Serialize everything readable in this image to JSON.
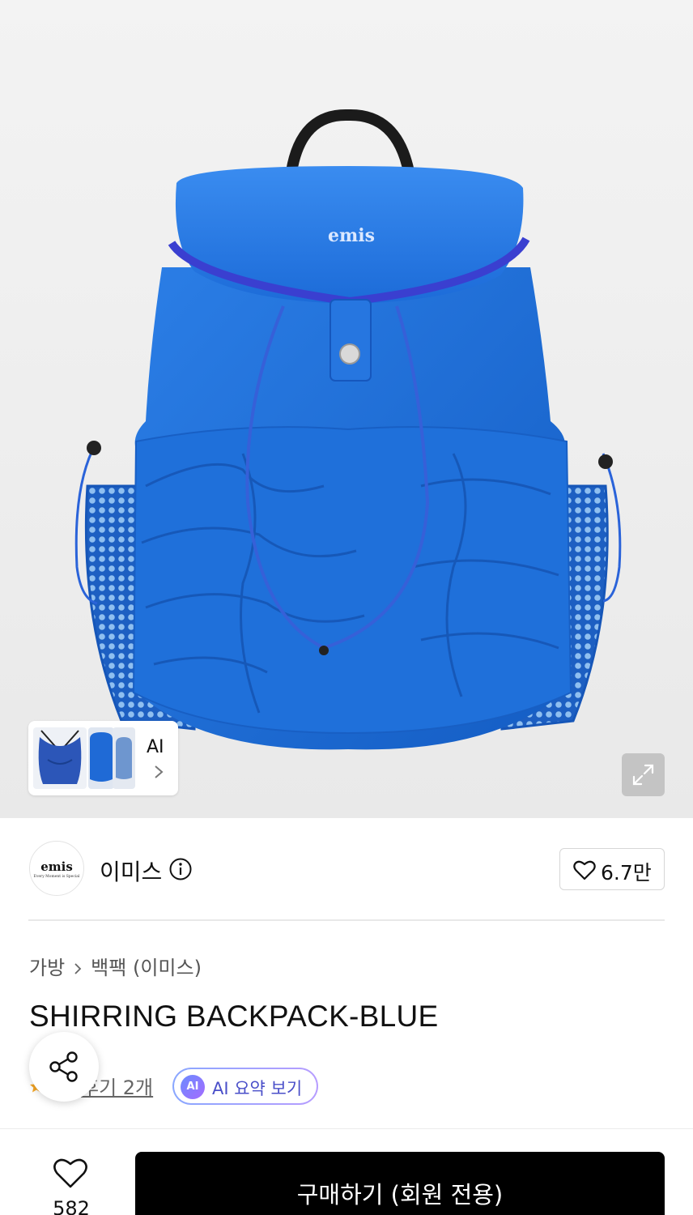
{
  "product": {
    "image_alt": "SHIRRING BACKPACK-BLUE",
    "logo_text": "emis",
    "color": "#1d6cd6"
  },
  "gallery": {
    "ai_label": "AI"
  },
  "brand": {
    "logo_text": "emis",
    "logo_subtext": "Every Moment is Special",
    "name": "이미스",
    "like_count": "6.7만"
  },
  "breadcrumb": {
    "category": "가방",
    "subcategory": "백팩 (이미스)"
  },
  "title": "SHIRRING BACKPACK-BLUE",
  "reviews": {
    "text": "후기 2개",
    "ai_badge": "AI",
    "ai_summary_label": "AI 요약 보기"
  },
  "bottom_bar": {
    "wish_count": "582",
    "buy_label": "구매하기 (회원 전용)"
  },
  "colors": {
    "accent_ai": "#4a4fc9",
    "buy_button": "#000000",
    "star": "#f5a623"
  }
}
